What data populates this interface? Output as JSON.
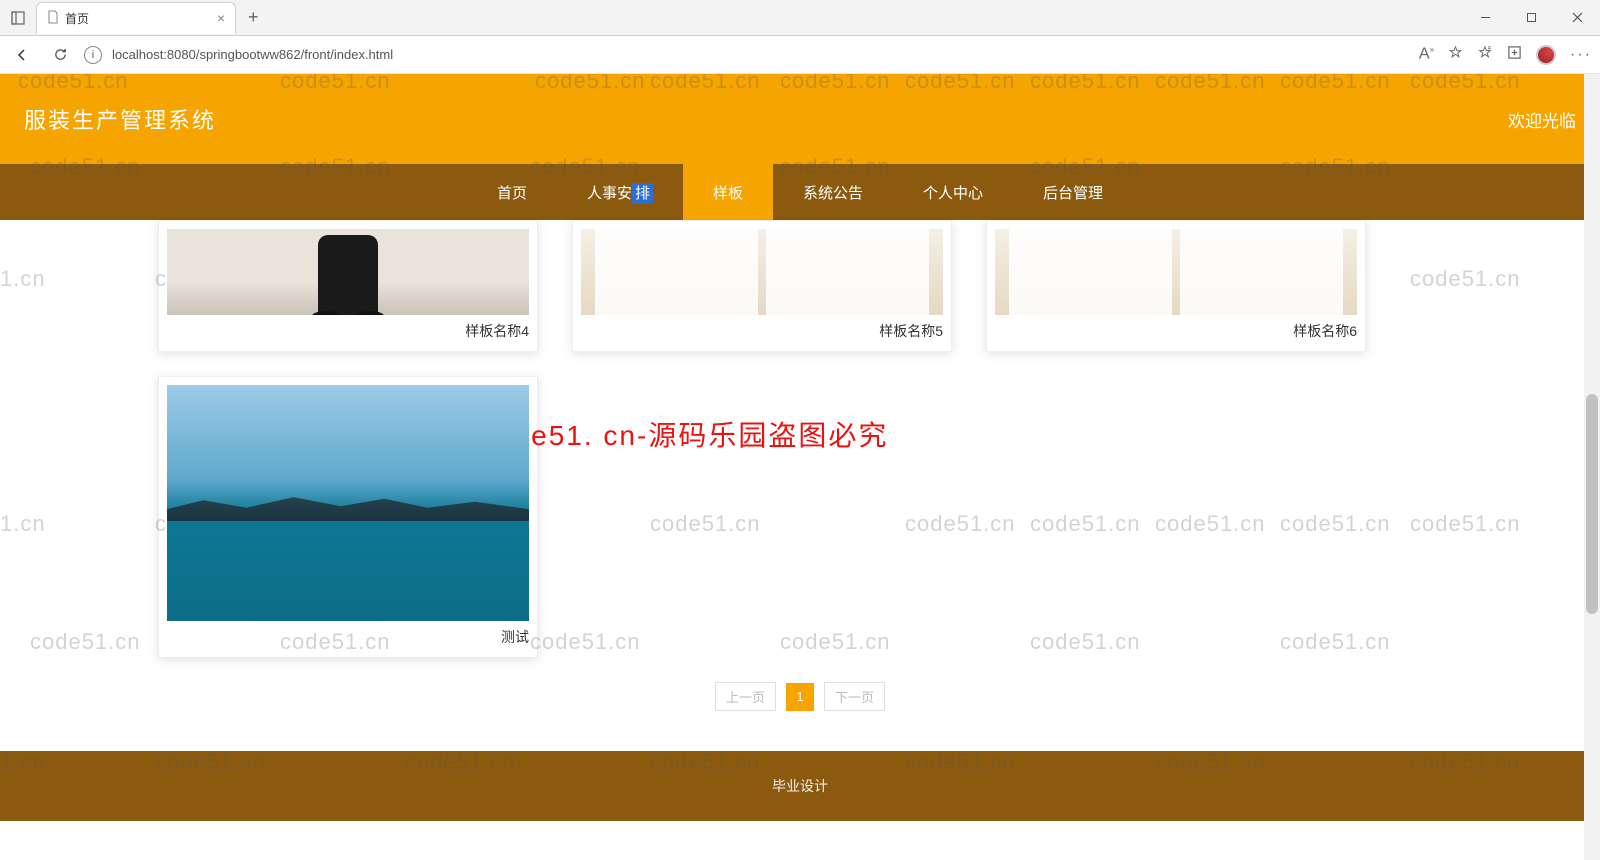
{
  "browser": {
    "tab_title": "首页",
    "url": "localhost:8080/springbootww862/front/index.html"
  },
  "header": {
    "site_title": "服装生产管理系统",
    "welcome": "欢迎光临"
  },
  "nav": {
    "items": [
      "首页",
      "人事安排",
      "样板",
      "系统公告",
      "个人中心",
      "后台管理"
    ]
  },
  "cards": {
    "row1": [
      {
        "label": "样板名称4"
      },
      {
        "label": "样板名称5"
      },
      {
        "label": "样板名称6"
      }
    ],
    "row2": [
      {
        "label": "测试"
      }
    ]
  },
  "pager": {
    "prev": "上一页",
    "page": "1",
    "next": "下一页"
  },
  "footer": {
    "text": "毕业设计"
  },
  "watermark": {
    "small": "code51.cn",
    "small_short": "1.cn",
    "big": "code51. cn-源码乐园盗图必究"
  }
}
